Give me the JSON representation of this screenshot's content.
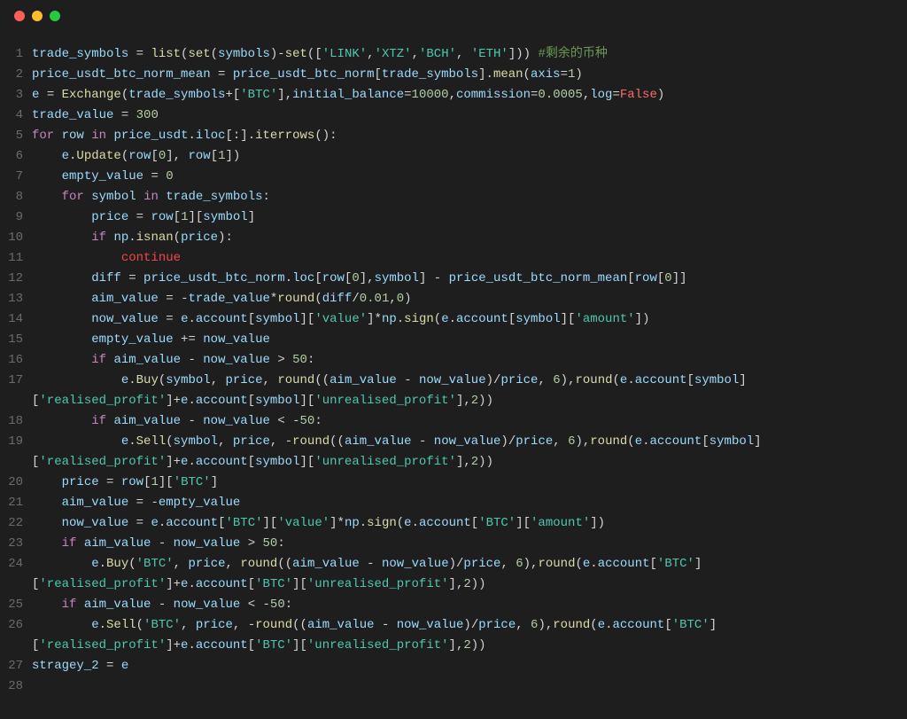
{
  "window": {
    "traffic_lights": [
      "close",
      "minimize",
      "zoom"
    ]
  },
  "code": {
    "lines": [
      {
        "n": 1,
        "indent": 0,
        "html": "<span class='id'>trade_symbols</span> <span class='op'>=</span> <span class='fn'>list</span>(<span class='fn'>set</span>(<span class='id'>symbols</span>)<span class='op'>-</span><span class='fn'>set</span>([<span class='strg'>'LINK'</span>,<span class='strg'>'XTZ'</span>,<span class='strg'>'BCH'</span>, <span class='strg'>'ETH'</span>])) <span class='cmt'>#剩余的币种</span>"
      },
      {
        "n": 2,
        "indent": 0,
        "html": "<span class='id'>price_usdt_btc_norm_mean</span> <span class='op'>=</span> <span class='id'>price_usdt_btc_norm</span>[<span class='id'>trade_symbols</span>].<span class='fn'>mean</span>(<span class='id'>axis</span><span class='op'>=</span><span class='num'>1</span>)"
      },
      {
        "n": 3,
        "indent": 0,
        "html": "<span class='id'>e</span> <span class='op'>=</span> <span class='fn'>Exchange</span>(<span class='id'>trade_symbols</span><span class='op'>+</span>[<span class='strg'>'BTC'</span>],<span class='id'>initial_balance</span><span class='op'>=</span><span class='num'>10000</span>,<span class='id'>commission</span><span class='op'>=</span><span class='num'>0.0005</span>,<span class='id'>log</span><span class='op'>=</span><span class='logfalse'>False</span>)"
      },
      {
        "n": 4,
        "indent": 0,
        "html": "<span class='id'>trade_value</span> <span class='op'>=</span> <span class='num'>300</span>"
      },
      {
        "n": 5,
        "indent": 0,
        "html": "<span class='kw'>for</span> <span class='id'>row</span> <span class='kw'>in</span> <span class='id'>price_usdt</span>.<span class='id'>iloc</span>[:].<span class='fn'>iterrows</span>():"
      },
      {
        "n": 6,
        "indent": 1,
        "html": "<span class='id'>e</span>.<span class='fn'>Update</span>(<span class='id'>row</span>[<span class='num'>0</span>], <span class='id'>row</span>[<span class='num'>1</span>])"
      },
      {
        "n": 7,
        "indent": 1,
        "html": "<span class='id'>empty_value</span> <span class='op'>=</span> <span class='num'>0</span>"
      },
      {
        "n": 8,
        "indent": 1,
        "html": "<span class='kw'>for</span> <span class='id'>symbol</span> <span class='kw'>in</span> <span class='id'>trade_symbols</span>:"
      },
      {
        "n": 9,
        "indent": 2,
        "html": "<span class='id'>price</span> <span class='op'>=</span> <span class='id'>row</span>[<span class='num'>1</span>][<span class='id'>symbol</span>]"
      },
      {
        "n": 10,
        "indent": 2,
        "html": "<span class='kw'>if</span> <span class='id'>np</span>.<span class='fn'>isnan</span>(<span class='id'>price</span>):"
      },
      {
        "n": 11,
        "indent": 3,
        "html": "<span class='red'>continue</span>"
      },
      {
        "n": 12,
        "indent": 2,
        "html": "<span class='id'>diff</span> <span class='op'>=</span> <span class='id'>price_usdt_btc_norm</span>.<span class='id'>loc</span>[<span class='id'>row</span>[<span class='num'>0</span>],<span class='id'>symbol</span>] <span class='op'>-</span> <span class='id'>price_usdt_btc_norm_mean</span>[<span class='id'>row</span>[<span class='num'>0</span>]]"
      },
      {
        "n": 13,
        "indent": 2,
        "html": "<span class='id'>aim_value</span> <span class='op'>=</span> <span class='op'>-</span><span class='id'>trade_value</span><span class='op'>*</span><span class='fn'>round</span>(<span class='id'>diff</span><span class='op'>/</span><span class='num'>0.01</span>,<span class='num'>0</span>)"
      },
      {
        "n": 14,
        "indent": 2,
        "html": "<span class='id'>now_value</span> <span class='op'>=</span> <span class='id'>e</span>.<span class='id'>account</span>[<span class='id'>symbol</span>][<span class='strg'>'value'</span>]<span class='op'>*</span><span class='id'>np</span>.<span class='fn'>sign</span>(<span class='id'>e</span>.<span class='id'>account</span>[<span class='id'>symbol</span>][<span class='strg'>'amount'</span>])"
      },
      {
        "n": 15,
        "indent": 2,
        "html": "<span class='id'>empty_value</span> <span class='op'>+=</span> <span class='id'>now_value</span>"
      },
      {
        "n": 16,
        "indent": 2,
        "html": "<span class='kw'>if</span> <span class='id'>aim_value</span> <span class='op'>-</span> <span class='id'>now_value</span> <span class='op'>&gt;</span> <span class='num'>50</span>:"
      },
      {
        "n": 17,
        "indent": 3,
        "html": "<span class='id'>e</span>.<span class='fn'>Buy</span>(<span class='id'>symbol</span>, <span class='id'>price</span>, <span class='fn'>round</span>((<span class='id'>aim_value</span> <span class='op'>-</span> <span class='id'>now_value</span>)<span class='op'>/</span><span class='id'>price</span>, <span class='num'>6</span>),<span class='fn'>round</span>(<span class='id'>e</span>.<span class='id'>account</span>[<span class='id'>symbol</span>]"
      },
      {
        "n": 17,
        "cont": true,
        "indent": 0,
        "html": "[<span class='strg'>'realised_profit'</span>]<span class='op'>+</span><span class='id'>e</span>.<span class='id'>account</span>[<span class='id'>symbol</span>][<span class='strg'>'unrealised_profit'</span>],<span class='num'>2</span>))"
      },
      {
        "n": 18,
        "indent": 2,
        "html": "<span class='kw'>if</span> <span class='id'>aim_value</span> <span class='op'>-</span> <span class='id'>now_value</span> <span class='op'>&lt;</span> <span class='op'>-</span><span class='num'>50</span>:"
      },
      {
        "n": 19,
        "indent": 3,
        "html": "<span class='id'>e</span>.<span class='fn'>Sell</span>(<span class='id'>symbol</span>, <span class='id'>price</span>, <span class='op'>-</span><span class='fn'>round</span>((<span class='id'>aim_value</span> <span class='op'>-</span> <span class='id'>now_value</span>)<span class='op'>/</span><span class='id'>price</span>, <span class='num'>6</span>),<span class='fn'>round</span>(<span class='id'>e</span>.<span class='id'>account</span>[<span class='id'>symbol</span>]"
      },
      {
        "n": 19,
        "cont": true,
        "indent": 0,
        "html": "[<span class='strg'>'realised_profit'</span>]<span class='op'>+</span><span class='id'>e</span>.<span class='id'>account</span>[<span class='id'>symbol</span>][<span class='strg'>'unrealised_profit'</span>],<span class='num'>2</span>))"
      },
      {
        "n": 20,
        "indent": 1,
        "html": "<span class='id'>price</span> <span class='op'>=</span> <span class='id'>row</span>[<span class='num'>1</span>][<span class='strg'>'BTC'</span>]"
      },
      {
        "n": 21,
        "indent": 1,
        "html": "<span class='id'>aim_value</span> <span class='op'>=</span> <span class='op'>-</span><span class='id'>empty_value</span>"
      },
      {
        "n": 22,
        "indent": 1,
        "html": "<span class='id'>now_value</span> <span class='op'>=</span> <span class='id'>e</span>.<span class='id'>account</span>[<span class='strg'>'BTC'</span>][<span class='strg'>'value'</span>]<span class='op'>*</span><span class='id'>np</span>.<span class='fn'>sign</span>(<span class='id'>e</span>.<span class='id'>account</span>[<span class='strg'>'BTC'</span>][<span class='strg'>'amount'</span>])"
      },
      {
        "n": 23,
        "indent": 1,
        "html": "<span class='kw'>if</span> <span class='id'>aim_value</span> <span class='op'>-</span> <span class='id'>now_value</span> <span class='op'>&gt;</span> <span class='num'>50</span>:"
      },
      {
        "n": 24,
        "indent": 2,
        "html": "<span class='id'>e</span>.<span class='fn'>Buy</span>(<span class='strg'>'BTC'</span>, <span class='id'>price</span>, <span class='fn'>round</span>((<span class='id'>aim_value</span> <span class='op'>-</span> <span class='id'>now_value</span>)<span class='op'>/</span><span class='id'>price</span>, <span class='num'>6</span>),<span class='fn'>round</span>(<span class='id'>e</span>.<span class='id'>account</span>[<span class='strg'>'BTC'</span>]"
      },
      {
        "n": 24,
        "cont": true,
        "indent": 0,
        "html": "[<span class='strg'>'realised_profit'</span>]<span class='op'>+</span><span class='id'>e</span>.<span class='id'>account</span>[<span class='strg'>'BTC'</span>][<span class='strg'>'unrealised_profit'</span>],<span class='num'>2</span>))"
      },
      {
        "n": 25,
        "indent": 1,
        "html": "<span class='kw'>if</span> <span class='id'>aim_value</span> <span class='op'>-</span> <span class='id'>now_value</span> <span class='op'>&lt;</span> <span class='op'>-</span><span class='num'>50</span>:"
      },
      {
        "n": 26,
        "indent": 2,
        "html": "<span class='id'>e</span>.<span class='fn'>Sell</span>(<span class='strg'>'BTC'</span>, <span class='id'>price</span>, <span class='op'>-</span><span class='fn'>round</span>((<span class='id'>aim_value</span> <span class='op'>-</span> <span class='id'>now_value</span>)<span class='op'>/</span><span class='id'>price</span>, <span class='num'>6</span>),<span class='fn'>round</span>(<span class='id'>e</span>.<span class='id'>account</span>[<span class='strg'>'BTC'</span>]"
      },
      {
        "n": 26,
        "cont": true,
        "indent": 0,
        "html": "[<span class='strg'>'realised_profit'</span>]<span class='op'>+</span><span class='id'>e</span>.<span class='id'>account</span>[<span class='strg'>'BTC'</span>][<span class='strg'>'unrealised_profit'</span>],<span class='num'>2</span>))"
      },
      {
        "n": 27,
        "indent": 0,
        "html": "<span class='id'>stragey_2</span> <span class='op'>=</span> <span class='id'>e</span>"
      },
      {
        "n": 28,
        "indent": 0,
        "html": ""
      }
    ]
  }
}
